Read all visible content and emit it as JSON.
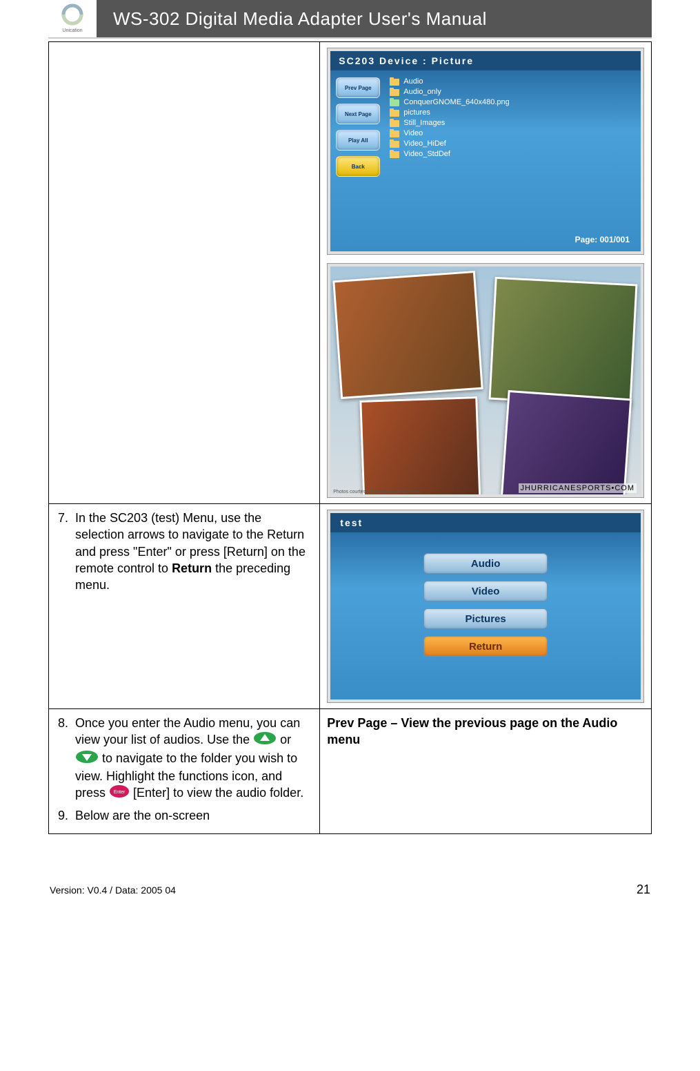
{
  "header": {
    "logo_label": "Unication",
    "title": "WS-302 Digital Media Adapter User's Manual"
  },
  "row1": {
    "device_title": "SC203 Device : Picture",
    "nav_buttons": [
      "Prev Page",
      "Next Page",
      "Play All",
      "Back"
    ],
    "file_list": [
      {
        "type": "folder",
        "name": "Audio"
      },
      {
        "type": "folder",
        "name": "Audio_only"
      },
      {
        "type": "file",
        "name": "ConquerGNOME_640x480.png"
      },
      {
        "type": "folder",
        "name": "pictures"
      },
      {
        "type": "folder",
        "name": "Still_Images"
      },
      {
        "type": "folder",
        "name": "Video"
      },
      {
        "type": "folder",
        "name": "Video_HiDef"
      },
      {
        "type": "folder",
        "name": "Video_StdDef"
      }
    ],
    "page_indicator": "Page:  001/001",
    "collage_url": "JHURRICANESPORTS•COM",
    "collage_caption": "Photos courtesy of the Associated Press"
  },
  "row2": {
    "step_num": "7.",
    "step_text_parts": {
      "p1": "In the SC203 (test) Menu, use the selection arrows to navigate to the Return and press \"Enter\" or press [Return] on the remote control to ",
      "bold": "Return",
      "p2": " the preceding menu."
    },
    "test_title": "test",
    "test_menu": [
      "Audio",
      "Video",
      "Pictures",
      "Return"
    ],
    "test_selected_index": 3
  },
  "row3": {
    "step8_num": "8.",
    "step8_parts": {
      "a": "Once you enter the Audio menu, you can view your list of audios. Use the ",
      "b": " or ",
      "c": " to navigate to the folder you wish to view. Highlight the functions icon, and press ",
      "enter_label": "Enter",
      "d": " [Enter] to view the audio folder."
    },
    "step9_num": "9.",
    "step9_text": "Below are the on-screen",
    "right_heading": "Prev Page – View the previous page on the Audio menu"
  },
  "footer": {
    "version": "Version: V0.4 / Data: 2005 04",
    "page_number": "21"
  }
}
